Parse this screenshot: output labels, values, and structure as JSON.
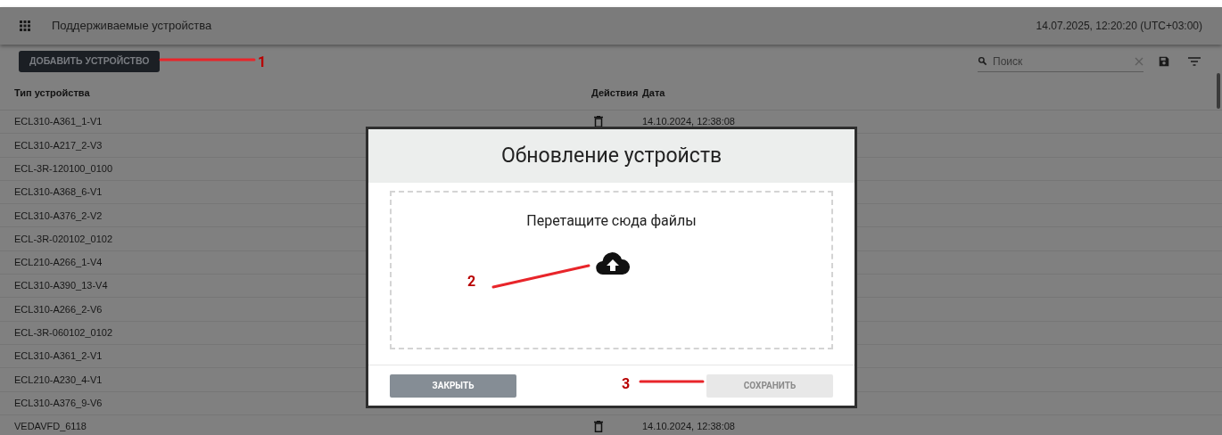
{
  "header": {
    "title": "Поддерживаемые устройства",
    "datetime": "14.07.2025, 12:20:20 (UTC+03:00)"
  },
  "toolbar": {
    "add_button": "ДОБАВИТЬ УСТРОЙСТВО",
    "search": {
      "placeholder": "Поиск"
    }
  },
  "table": {
    "columns": [
      "Тип устройства",
      "Действия",
      "Дата"
    ],
    "rows": [
      {
        "device_type": "ECL310-A361_1-V1",
        "date": "14.10.2024, 12:38:08"
      },
      {
        "device_type": "ECL310-A217_2-V3"
      },
      {
        "device_type": "ECL-3R-120100_0100"
      },
      {
        "device_type": "ECL310-A368_6-V1"
      },
      {
        "device_type": "ECL310-A376_2-V2"
      },
      {
        "device_type": "ECL-3R-020102_0102"
      },
      {
        "device_type": "ECL210-A266_1-V4"
      },
      {
        "device_type": "ECL310-A390_13-V4"
      },
      {
        "device_type": "ECL310-A266_2-V6"
      },
      {
        "device_type": "ECL-3R-060102_0102"
      },
      {
        "device_type": "ECL310-A361_2-V1"
      },
      {
        "device_type": "ECL210-A230_4-V1"
      },
      {
        "device_type": "ECL310-A376_9-V6"
      },
      {
        "device_type": "VEDAVFD_6118",
        "date": "14.10.2024, 12:38:08"
      }
    ]
  },
  "modal": {
    "title": "Обновление устройств",
    "dropzone_text": "Перетащите сюда файлы",
    "buttons": [
      {
        "label": "ЗАКРЫТЬ",
        "disabled": false
      },
      {
        "label": "СОХРАНИТЬ",
        "disabled": true
      }
    ]
  },
  "annotations": [
    {
      "label": "1"
    },
    {
      "label": "2"
    },
    {
      "label": "3"
    }
  ]
}
